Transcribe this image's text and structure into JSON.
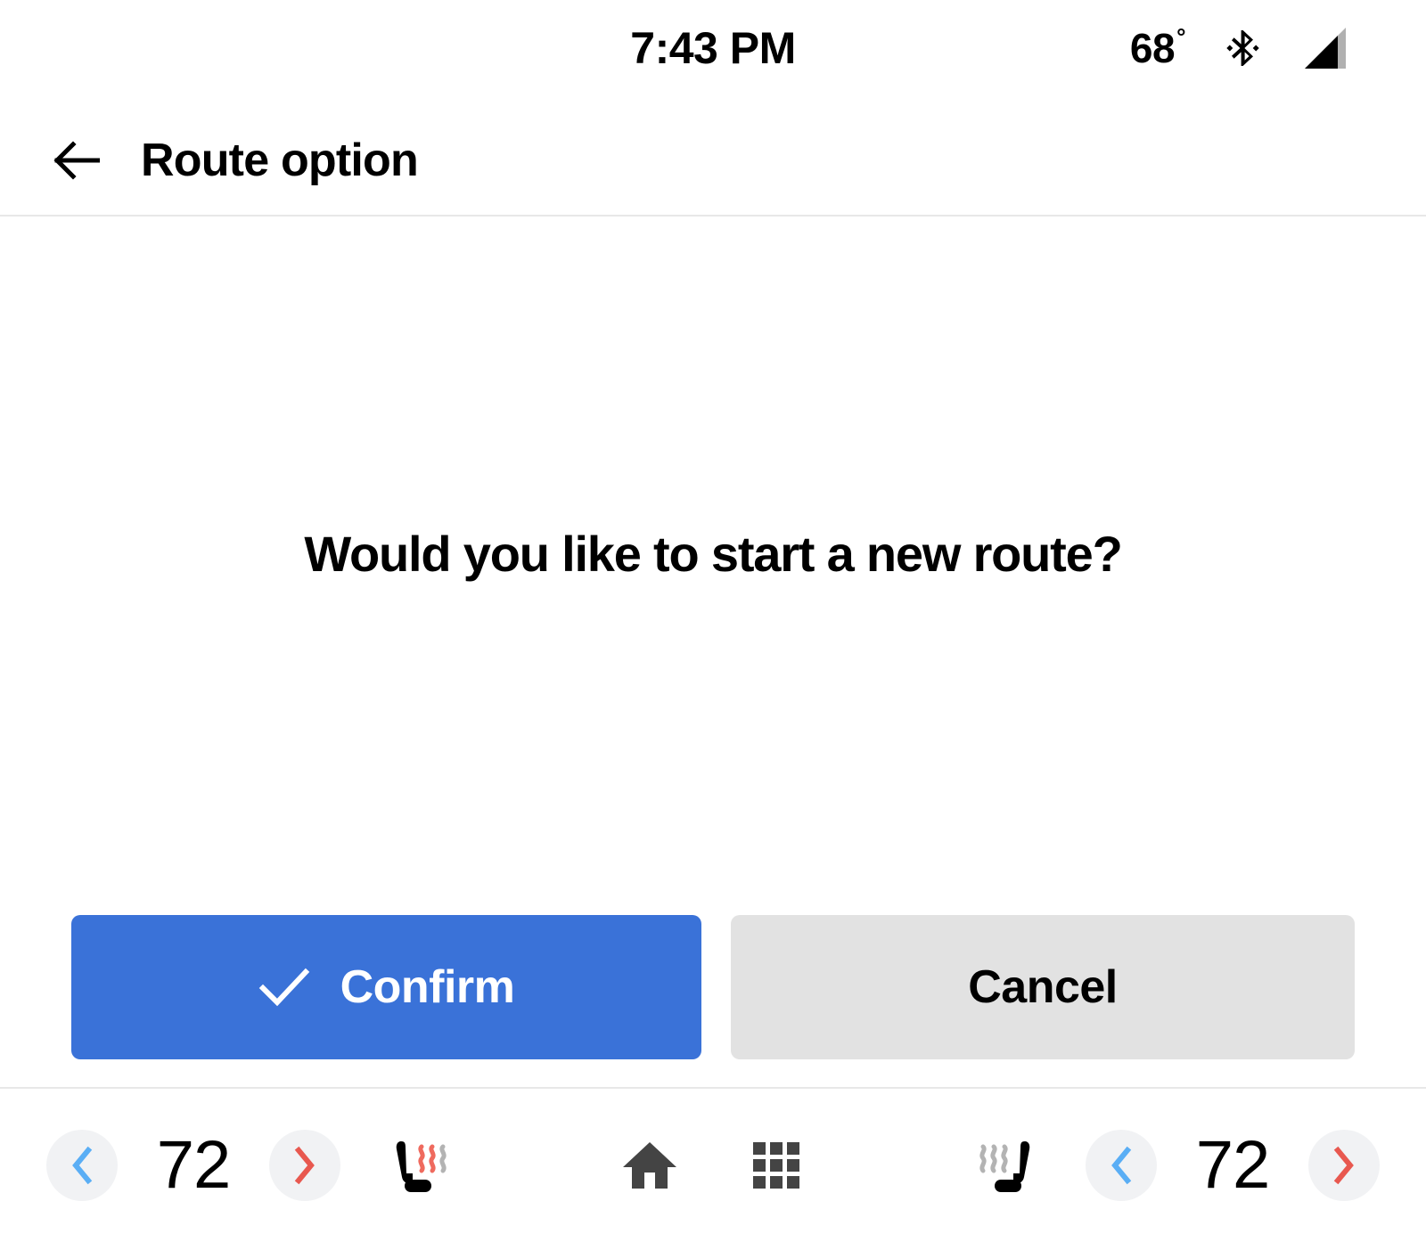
{
  "status_bar": {
    "clock": "7:43 PM",
    "temperature": "68",
    "degree_symbol": "°",
    "bluetooth_icon": "bluetooth-icon",
    "signal_icon": "cellular-signal-icon"
  },
  "app_bar": {
    "back_icon": "arrow-left-icon",
    "title": "Route option"
  },
  "main": {
    "prompt": "Would you like to start a new route?",
    "confirm": {
      "label": "Confirm",
      "icon": "check-icon",
      "background_color": "#3a72d8",
      "text_color": "#ffffff"
    },
    "cancel": {
      "label": "Cancel",
      "background_color": "#e2e2e2",
      "text_color": "#000000"
    }
  },
  "climate_bar": {
    "colors": {
      "decrease_chevron": "#5aaef5",
      "increase_chevron": "#e8584f",
      "circle_background": "#f1f2f4",
      "heat_active": "#ef6a5e",
      "heat_inactive": "#b3b3b3",
      "nav_icon": "#444444"
    },
    "left": {
      "decrease_icon": "chevron-left-icon",
      "temperature": "72",
      "increase_icon": "chevron-right-icon",
      "seat_icon": "heated-seat-left-icon",
      "seat_heat_level": 2,
      "seat_heat_max": 3
    },
    "right": {
      "seat_icon": "heated-seat-right-icon",
      "seat_heat_level": 0,
      "seat_heat_max": 3,
      "decrease_icon": "chevron-left-icon",
      "temperature": "72",
      "increase_icon": "chevron-right-icon"
    },
    "center": {
      "home_icon": "home-icon",
      "apps_icon": "apps-grid-icon"
    }
  }
}
